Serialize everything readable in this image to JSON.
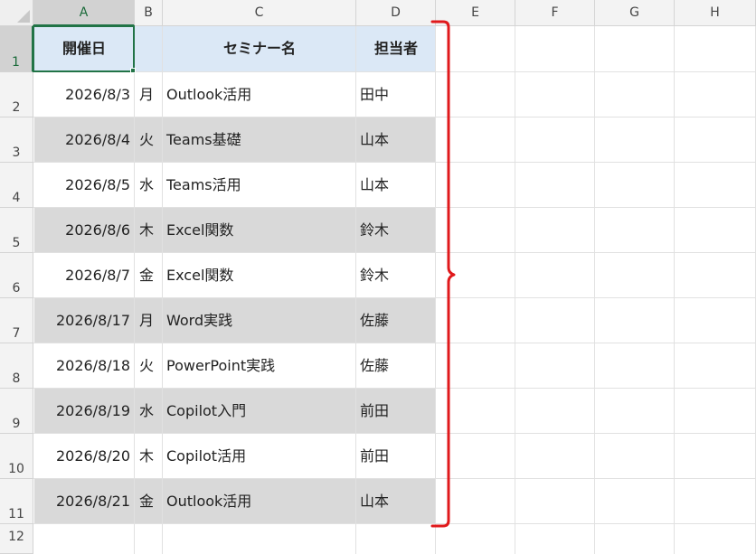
{
  "columns": [
    "A",
    "B",
    "C",
    "D",
    "E",
    "F",
    "G",
    "H"
  ],
  "rows": [
    "1",
    "2",
    "3",
    "4",
    "5",
    "6",
    "7",
    "8",
    "9",
    "10",
    "11",
    "12"
  ],
  "header": {
    "date": "開催日",
    "seminar": "セミナー名",
    "person": "担当者"
  },
  "records": [
    {
      "date": "2026/8/3",
      "day": "月",
      "seminar": "Outlook活用",
      "person": "田中"
    },
    {
      "date": "2026/8/4",
      "day": "火",
      "seminar": "Teams基礎",
      "person": "山本"
    },
    {
      "date": "2026/8/5",
      "day": "水",
      "seminar": "Teams活用",
      "person": "山本"
    },
    {
      "date": "2026/8/6",
      "day": "木",
      "seminar": "Excel関数",
      "person": "鈴木"
    },
    {
      "date": "2026/8/7",
      "day": "金",
      "seminar": "Excel関数",
      "person": "鈴木"
    },
    {
      "date": "2026/8/17",
      "day": "月",
      "seminar": "Word実践",
      "person": "佐藤"
    },
    {
      "date": "2026/8/18",
      "day": "火",
      "seminar": "PowerPoint実践",
      "person": "佐藤"
    },
    {
      "date": "2026/8/19",
      "day": "水",
      "seminar": "Copilot入門",
      "person": "前田"
    },
    {
      "date": "2026/8/20",
      "day": "木",
      "seminar": "Copilot活用",
      "person": "前田"
    },
    {
      "date": "2026/8/21",
      "day": "金",
      "seminar": "Outlook活用",
      "person": "山本"
    }
  ],
  "colors": {
    "header_fill": "#dbe8f6",
    "band_fill": "#d9d9d9",
    "selection": "#217346",
    "brace": "#e0191b"
  }
}
